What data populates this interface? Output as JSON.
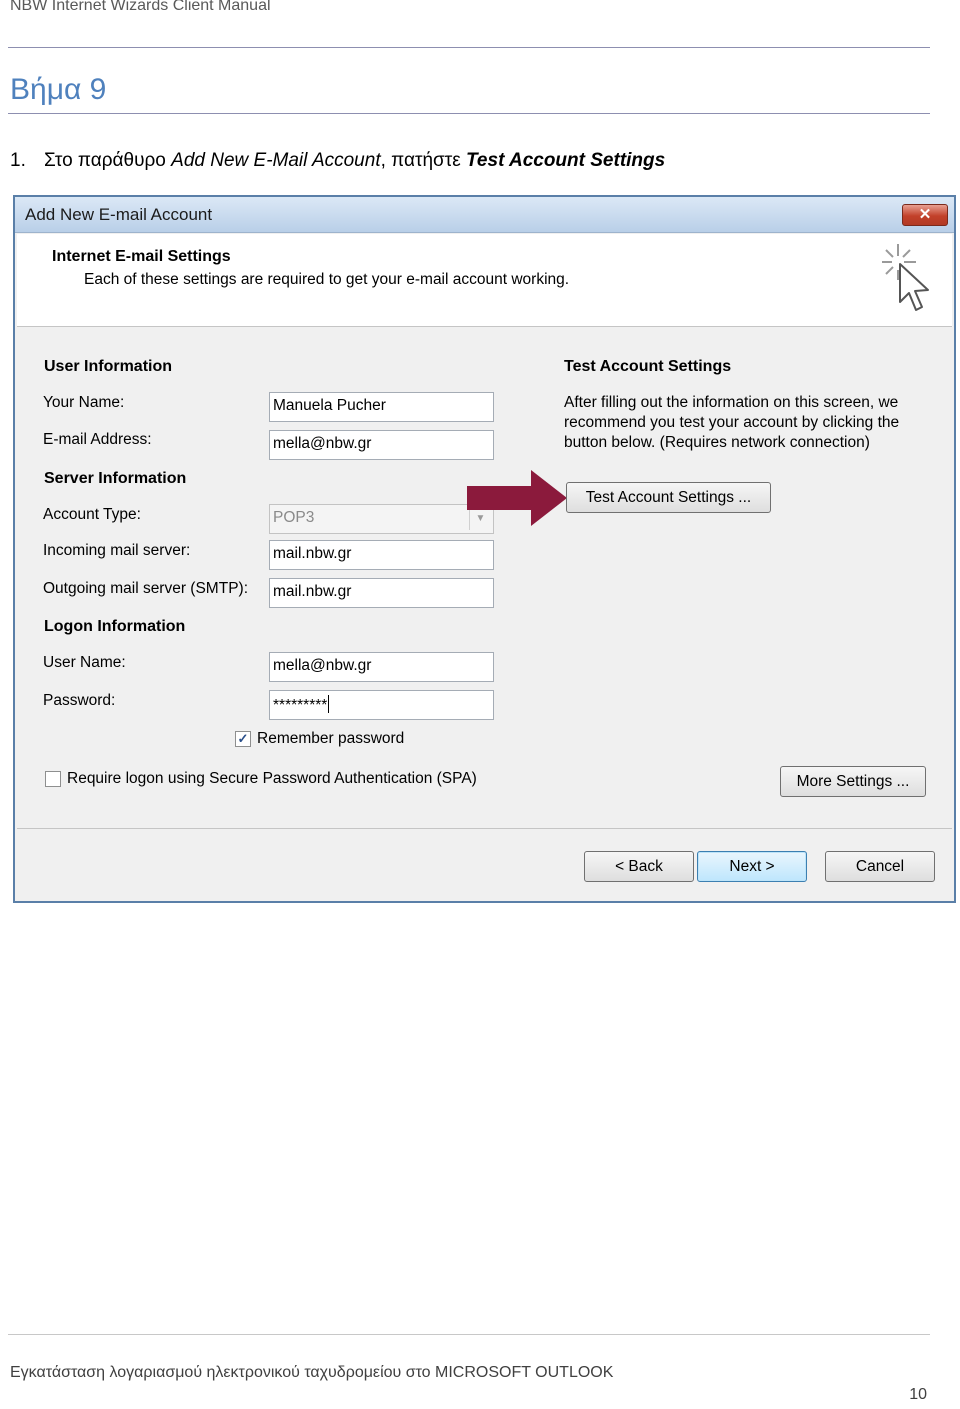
{
  "document": {
    "header": "NBW Internet Wizards Client Manual",
    "step_heading": "Βήμα 9",
    "instruction": {
      "number": "1.",
      "prefix": "Στο παράθυρο ",
      "window_name": "Add New E-Mail Account",
      "middle": ", πατήστε ",
      "target": "Test Account Settings"
    },
    "footer": "Εγκατάσταση λογαριασμού ηλεκτρονικού ταχυδρομείου στο MICROSOFT OUTLOOK",
    "page_number": "10"
  },
  "dialog": {
    "title": "Add New E-mail Account",
    "close_icon": "close-icon",
    "header_title": "Internet E-mail Settings",
    "header_subtitle": "Each of these settings are required to get your e-mail account working.",
    "wizard_icon": "cursor-sparkle-icon",
    "user_info": {
      "title": "User Information",
      "name_label": "Your Name:",
      "name_value": "Manuela Pucher",
      "email_label": "E-mail Address:",
      "email_value": "mella@nbw.gr"
    },
    "server_info": {
      "title": "Server Information",
      "account_type_label": "Account Type:",
      "account_type_value": "POP3",
      "incoming_label": "Incoming mail server:",
      "incoming_value": "mail.nbw.gr",
      "outgoing_label": "Outgoing mail server (SMTP):",
      "outgoing_value": "mail.nbw.gr"
    },
    "logon_info": {
      "title": "Logon Information",
      "username_label": "User Name:",
      "username_value": "mella@nbw.gr",
      "password_label": "Password:",
      "password_value": "*********",
      "remember_label": "Remember password",
      "remember_checked": true,
      "spa_label": "Require logon using Secure Password Authentication (SPA)",
      "spa_checked": false
    },
    "test_settings": {
      "title": "Test Account Settings",
      "description": "After filling out the information on this screen, we recommend you test your account by clicking the button below. (Requires network connection)",
      "button_label": "Test Account Settings ..."
    },
    "more_settings_label": "More Settings ...",
    "back_label": "< Back",
    "next_label": "Next >",
    "cancel_label": "Cancel",
    "arrow_color": "#8b1a3c"
  }
}
